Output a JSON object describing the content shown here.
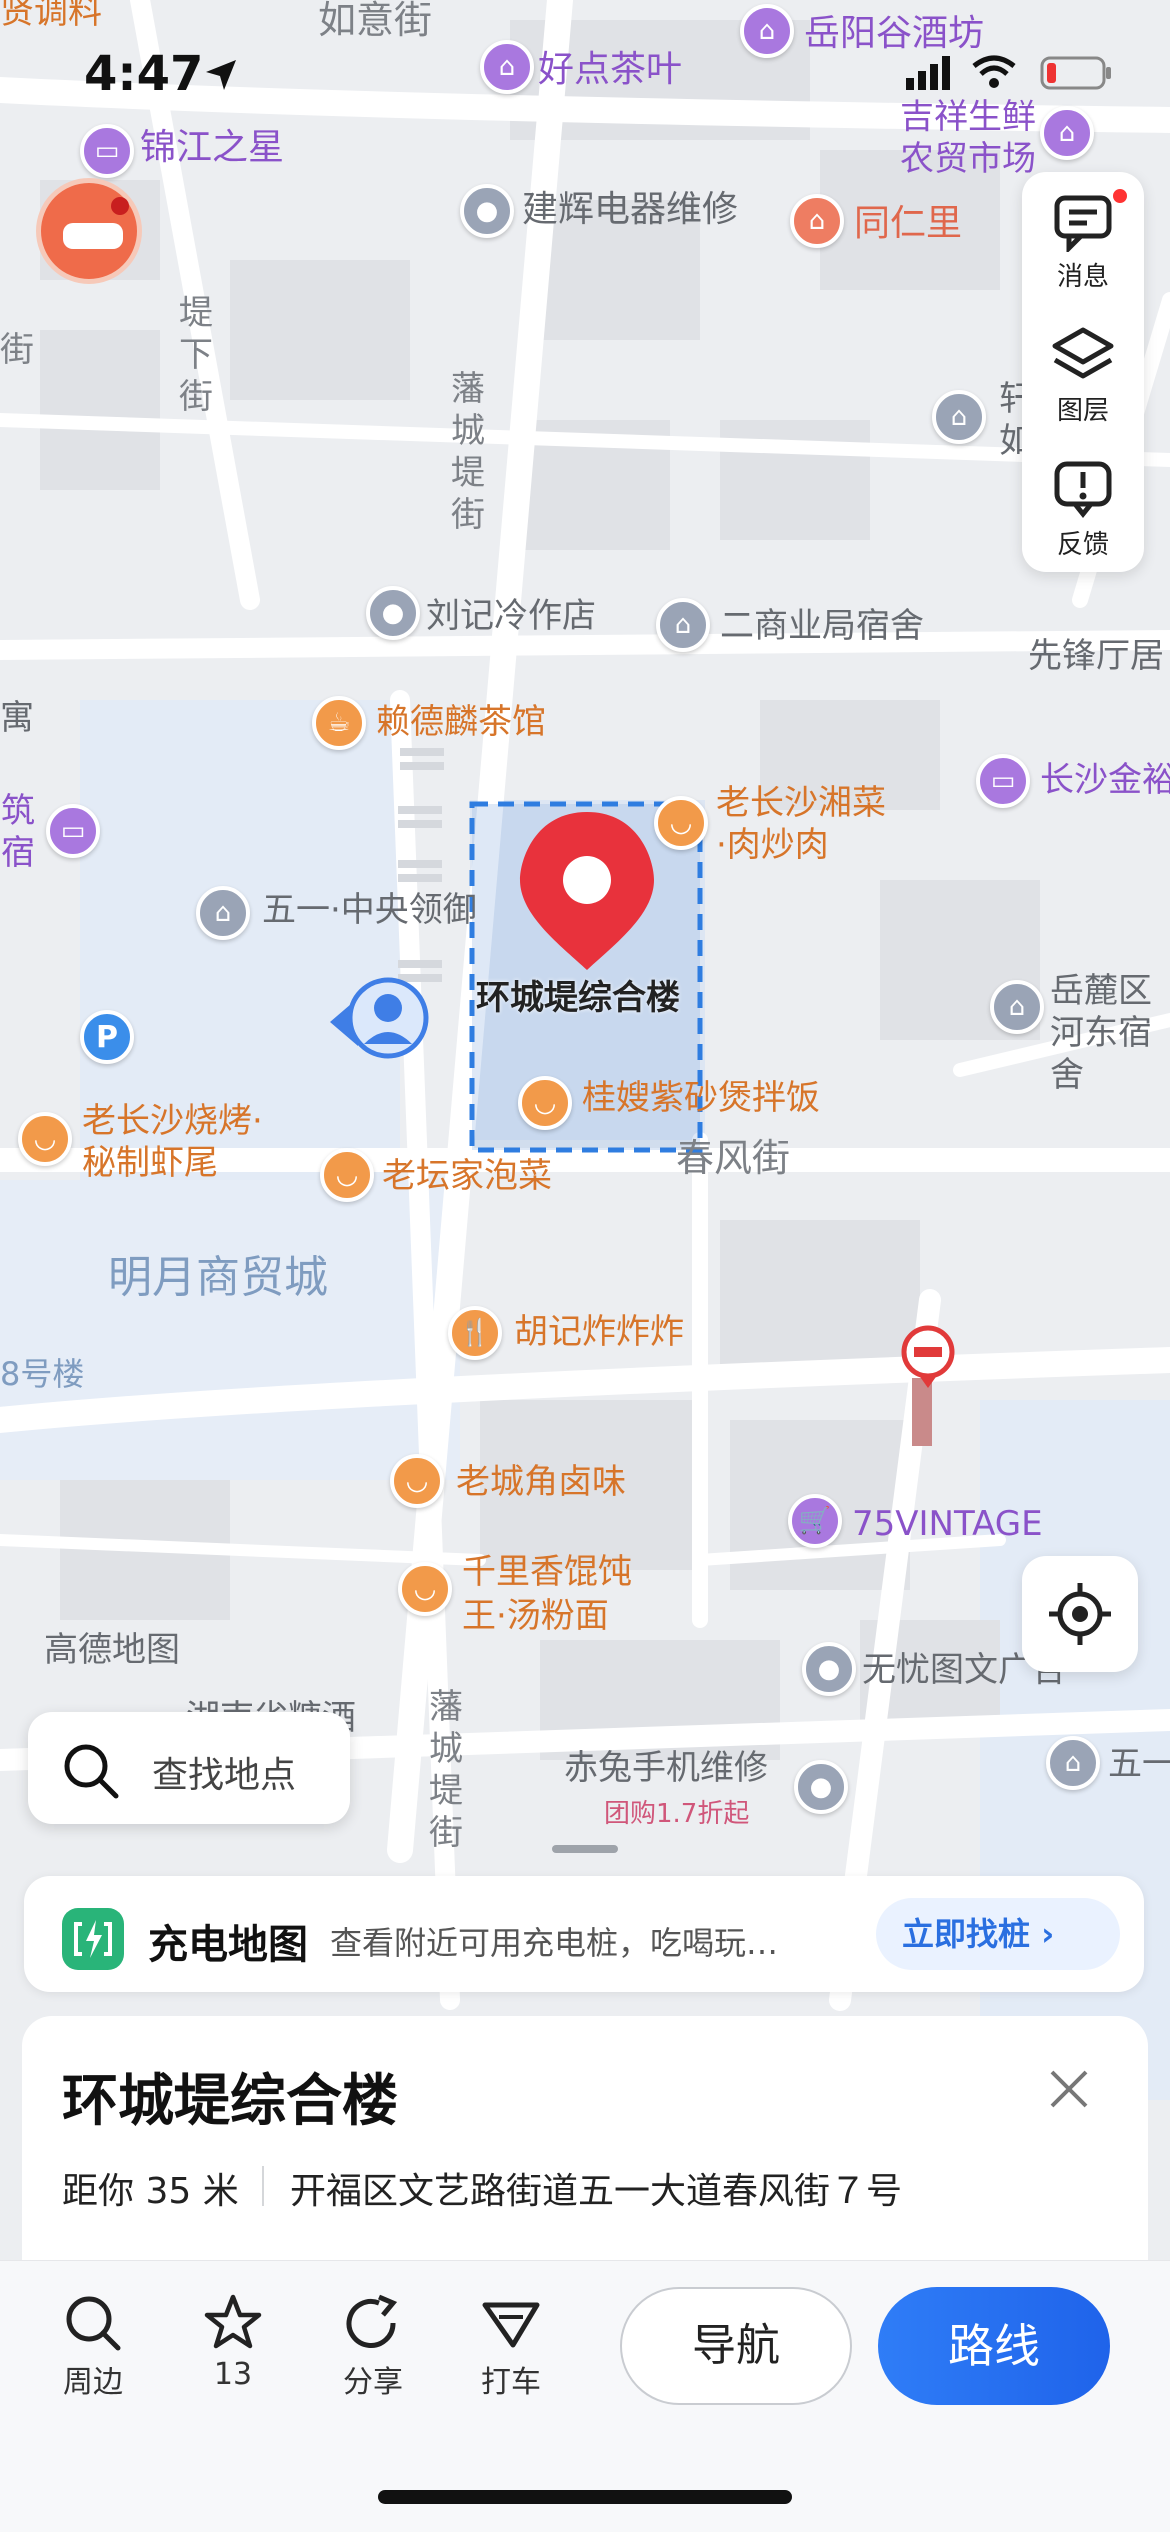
{
  "status_bar": {
    "time": "4:47"
  },
  "map": {
    "streets": [
      {
        "id": "ruyi",
        "text": "如意街"
      },
      {
        "id": "dixia",
        "text": "堤下街"
      },
      {
        "id": "fancheng-top",
        "text": "藩城堤街"
      },
      {
        "id": "fancheng-bottom",
        "text": "藩城堤街"
      },
      {
        "id": "chunfeng",
        "text": "春风街"
      },
      {
        "id": "left-fragment",
        "text": "街"
      }
    ],
    "areas": [
      {
        "id": "mingyue",
        "text": "明月商贸城"
      },
      {
        "id": "building8",
        "text": "8号楼"
      },
      {
        "id": "gaode",
        "text": "高德地图"
      }
    ],
    "pois": [
      {
        "id": "top-left-fragment",
        "text": "贤调料"
      },
      {
        "id": "haodian",
        "text": "好点茶叶"
      },
      {
        "id": "yueyanggu",
        "text": "岳阳谷酒坊"
      },
      {
        "id": "jinjiang",
        "text": "锦江之星"
      },
      {
        "id": "jixiang",
        "text": "吉祥生鲜农贸市场"
      },
      {
        "id": "jianhui",
        "text": "建辉电器维修"
      },
      {
        "id": "tongrenli",
        "text": "同仁里"
      },
      {
        "id": "liuji",
        "text": "刘记冷作店"
      },
      {
        "id": "ershang",
        "text": "二商业局宿舍"
      },
      {
        "id": "xianzhu",
        "text": "先锋厅居"
      },
      {
        "id": "laideqi",
        "text": "赖德麟茶馆"
      },
      {
        "id": "laochangsha-xiang",
        "text": "老长沙湘菜·肉炒肉"
      },
      {
        "id": "changsha-jin",
        "text": "长沙金裕"
      },
      {
        "id": "yu-fragment",
        "text": "寓"
      },
      {
        "id": "zhusu",
        "text": "筑宿"
      },
      {
        "id": "wuyi-zhongyang",
        "text": "五一·中央领御"
      },
      {
        "id": "yuelu",
        "text": "岳麓区河东宿舍"
      },
      {
        "id": "guisao",
        "text": "桂嫂紫砂煲拌饭"
      },
      {
        "id": "laochangsha-shaokao",
        "text": "老长沙烧烤·秘制虾尾"
      },
      {
        "id": "laotan",
        "text": "老坛家泡菜"
      },
      {
        "id": "huji",
        "text": "胡记炸炸炸"
      },
      {
        "id": "laocheng",
        "text": "老城角卤味"
      },
      {
        "id": "vintage",
        "text": "75VINTAGE"
      },
      {
        "id": "qianlixiang",
        "text": "千里香馄饨王·汤粉面"
      },
      {
        "id": "wuyou",
        "text": "无忧图文广告"
      },
      {
        "id": "hunan",
        "text": "湖南省糖酒"
      },
      {
        "id": "chitu",
        "text": "赤兔手机维修"
      },
      {
        "id": "tuangou",
        "text": "团购1.7折起"
      },
      {
        "id": "wuyi-right",
        "text": "五一"
      },
      {
        "id": "xuan",
        "text": "轩如"
      }
    ],
    "selected_label": "环城堤综合楼"
  },
  "toolbar_right": {
    "messages_label": "消息",
    "layers_label": "图层",
    "feedback_label": "反馈"
  },
  "search": {
    "placeholder": "查找地点"
  },
  "charging": {
    "title": "充电地图",
    "description": "查看附近可用充电桩，吃喝玩…",
    "button": "立即找桩 ›"
  },
  "place_card": {
    "title": "环城堤综合楼",
    "distance": "距你 35 米",
    "address": "开福区文艺路街道五一大道春风街７号"
  },
  "bottom_bar": {
    "nearby": "周边",
    "favorites_count": "13",
    "share": "分享",
    "taxi": "打车",
    "navigate": "导航",
    "route": "路线"
  },
  "colors": {
    "accent_blue": "#2a6fe0",
    "selection_red": "#e8323c",
    "charging_green": "#29b479"
  }
}
